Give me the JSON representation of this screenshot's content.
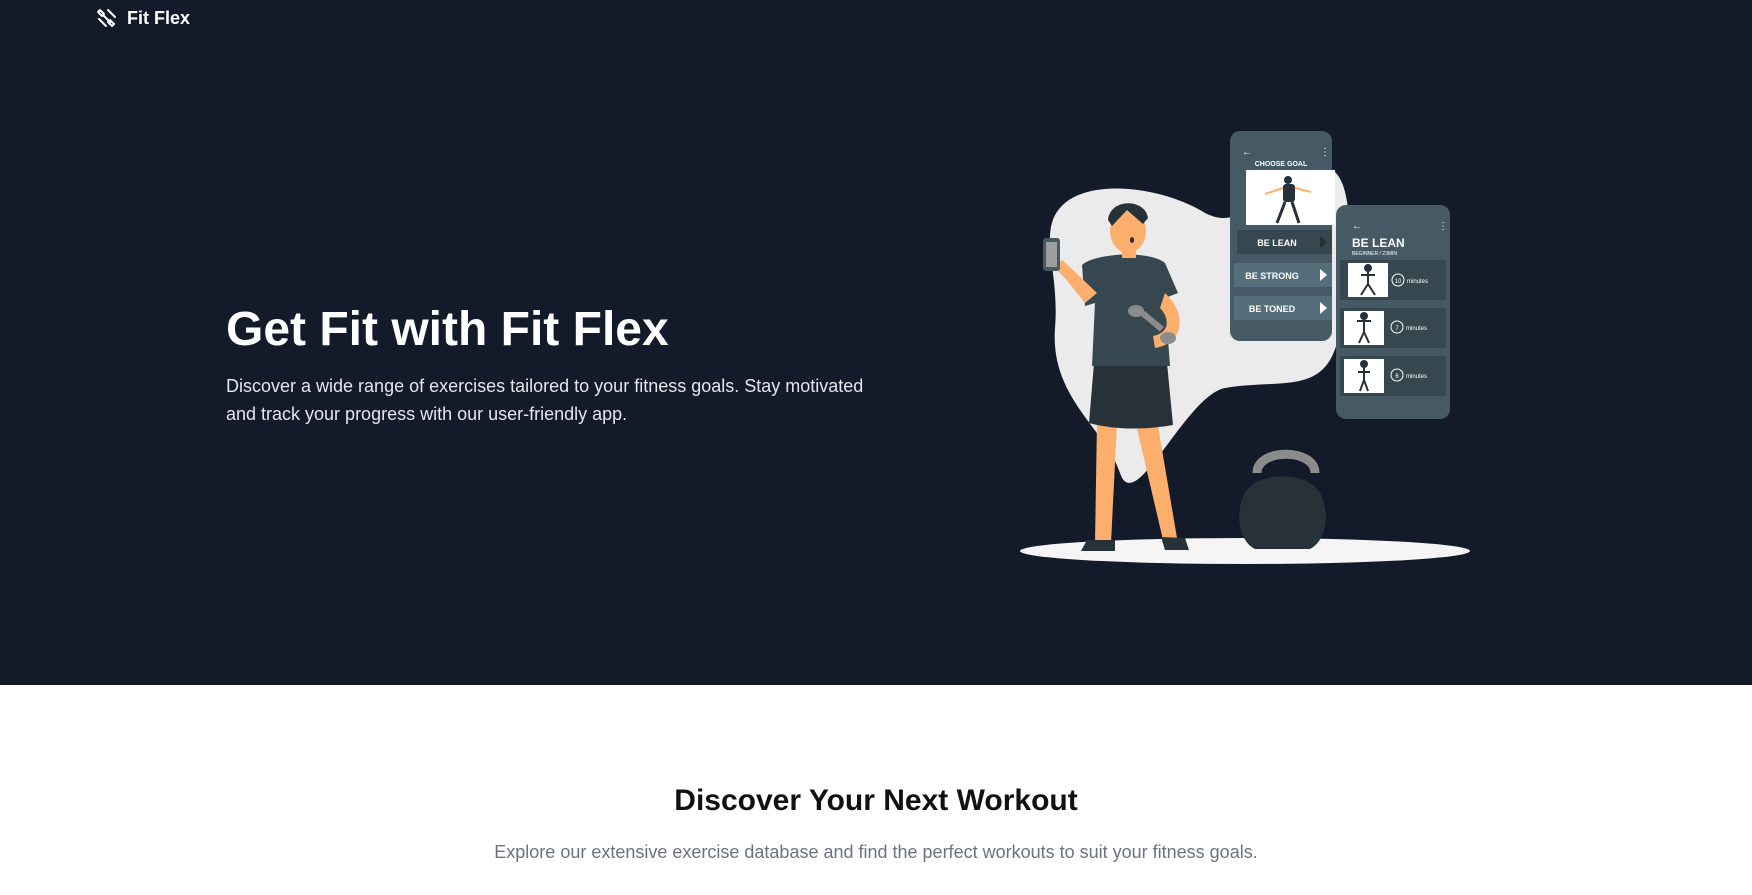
{
  "nav": {
    "brand": "Fit Flex",
    "logo_icon": "dumbbell-icon"
  },
  "hero": {
    "title": "Get Fit with Fit Flex",
    "description": "Discover a wide range of exercises tailored to your fitness goals. Stay motivated and track your progress with our user-friendly app."
  },
  "illustration": {
    "phone1": {
      "header": "CHOOSE GOAL",
      "options": [
        "BE LEAN",
        "BE STRONG",
        "BE TONED"
      ]
    },
    "phone2": {
      "title": "BE LEAN",
      "subtitle": "BEGINNER / 23MIN",
      "workouts": [
        {
          "minutes": "10",
          "unit": "minutes"
        },
        {
          "minutes": "7",
          "unit": "minutes"
        },
        {
          "minutes": "6",
          "unit": "minutes"
        }
      ]
    }
  },
  "discover": {
    "title": "Discover Your Next Workout",
    "description": "Explore our extensive exercise database and find the perfect workouts to suit your fitness goals."
  },
  "colors": {
    "hero_bg": "#131a2a",
    "skin": "#fcae6d",
    "shirt": "#37474f",
    "phone": "#455a64"
  }
}
